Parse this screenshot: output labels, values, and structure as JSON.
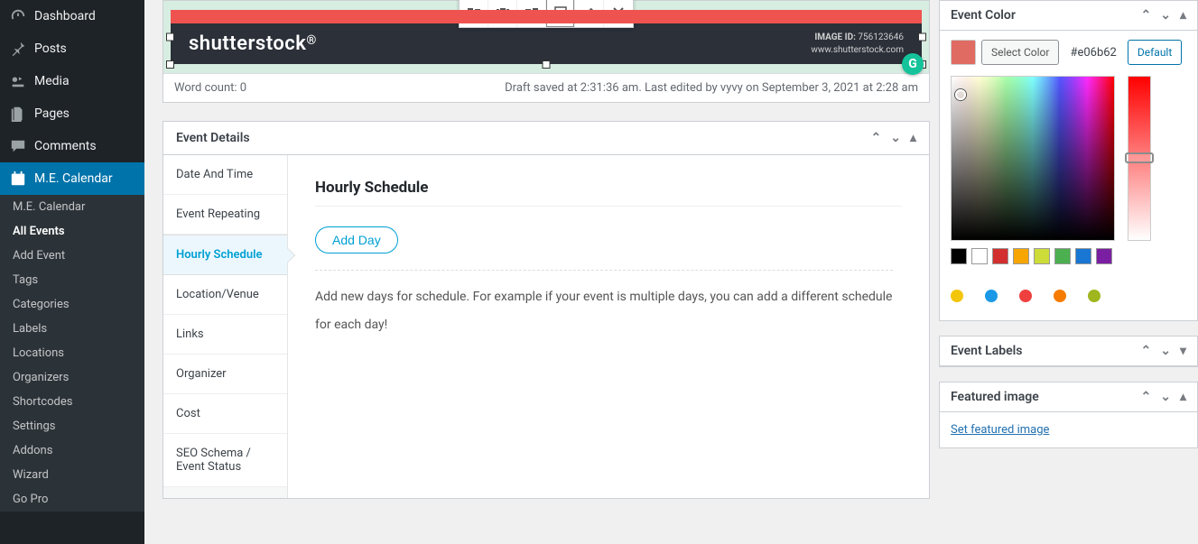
{
  "sidebar": {
    "main_items": [
      {
        "icon": "dashboard",
        "label": "Dashboard"
      },
      {
        "icon": "pin",
        "label": "Posts"
      },
      {
        "icon": "media",
        "label": "Media"
      },
      {
        "icon": "pages",
        "label": "Pages"
      },
      {
        "icon": "comments",
        "label": "Comments"
      },
      {
        "icon": "calendar",
        "label": "M.E. Calendar",
        "active": true
      }
    ],
    "submenu": [
      {
        "label": "M.E. Calendar"
      },
      {
        "label": "All Events",
        "current": true
      },
      {
        "label": "Add Event"
      },
      {
        "label": "Tags"
      },
      {
        "label": "Categories"
      },
      {
        "label": "Labels"
      },
      {
        "label": "Locations"
      },
      {
        "label": "Organizers"
      },
      {
        "label": "Shortcodes"
      },
      {
        "label": "Settings"
      },
      {
        "label": "Addons"
      },
      {
        "label": "Wizard"
      },
      {
        "label": "Go Pro"
      }
    ]
  },
  "editor": {
    "shutterstock_text": "shutterstock",
    "image_id_label": "IMAGE ID:",
    "image_id": "756123646",
    "image_source": "www.shutterstock.com",
    "word_count": "Word count: 0",
    "status": "Draft saved at 2:31:36 am. Last edited by vyvy on September 3, 2021 at 2:28 am"
  },
  "event_details": {
    "title": "Event Details",
    "tabs": [
      "Date And Time",
      "Event Repeating",
      "Hourly Schedule",
      "Location/Venue",
      "Links",
      "Organizer",
      "Cost",
      "SEO Schema / Event Status"
    ],
    "active_tab_index": 2,
    "content": {
      "heading": "Hourly Schedule",
      "add_button": "Add Day",
      "description": "Add new days for schedule. For example if your event is multiple days, you can add a different schedule for each day!"
    }
  },
  "event_color": {
    "title": "Event Color",
    "select_label": "Select Color",
    "hex": "#e06b62",
    "default_label": "Default",
    "swatches": [
      "#000000",
      "#ffffff",
      "#d32f2f",
      "#f7a500",
      "#cddc39",
      "#4caf50",
      "#1976d2",
      "#7b1fa2"
    ],
    "tag_dots": [
      "#f4c60b",
      "#1c99e6",
      "#ef4040",
      "#f57c00",
      "#9fb61f"
    ]
  },
  "event_labels": {
    "title": "Event Labels"
  },
  "featured_image": {
    "title": "Featured image",
    "link": "Set featured image"
  }
}
